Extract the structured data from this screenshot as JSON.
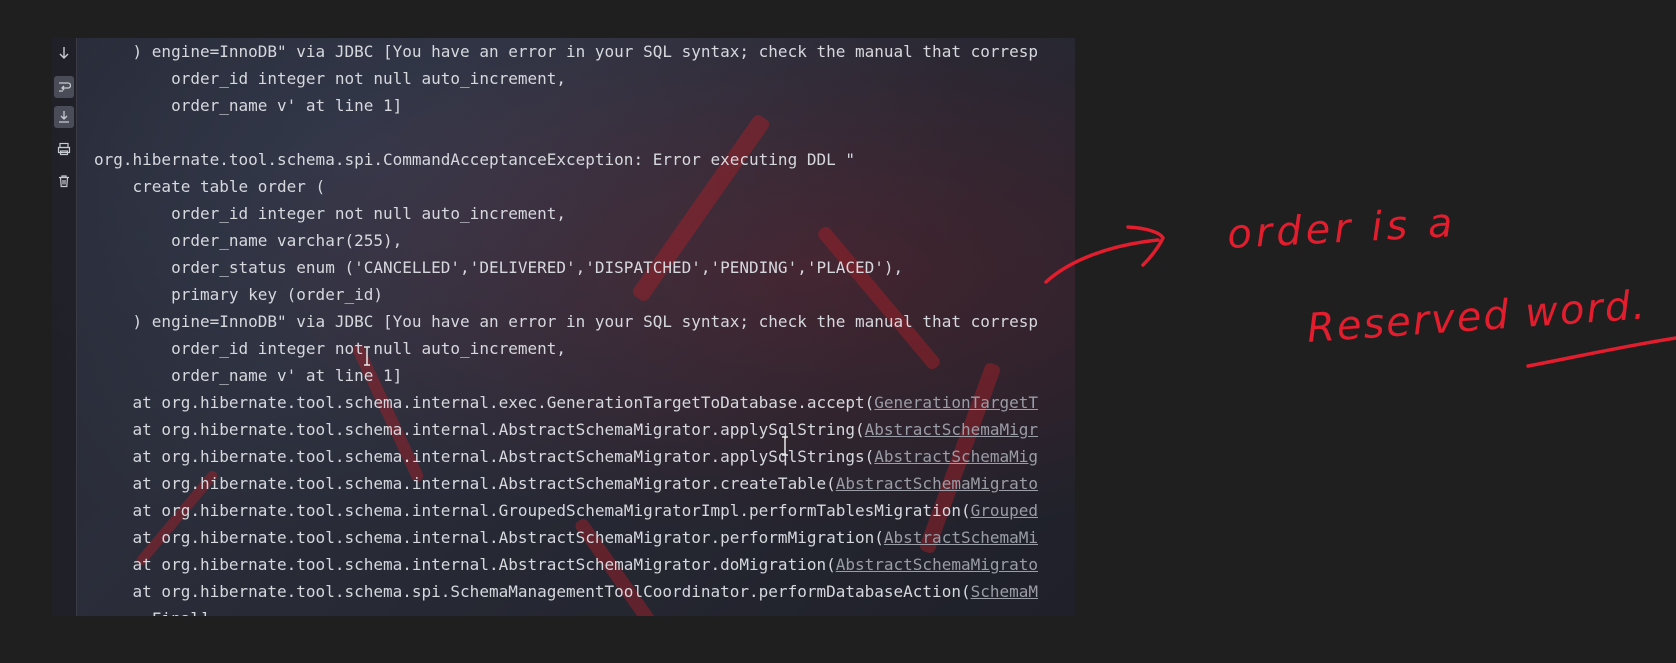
{
  "console": {
    "lines": [
      {
        "indent": "    ",
        "text": ") engine=InnoDB\" via JDBC [You have an error in your SQL syntax; check the manual that corresp",
        "link": ""
      },
      {
        "indent": "        ",
        "text": "order_id integer not null auto_increment,",
        "link": ""
      },
      {
        "indent": "        ",
        "text": "order_name v' at line 1]",
        "link": ""
      },
      {
        "indent": "",
        "text": "",
        "link": ""
      },
      {
        "indent": "",
        "text": "org.hibernate.tool.schema.spi.CommandAcceptanceException: Error executing DDL \"",
        "link": ""
      },
      {
        "indent": "    ",
        "text": "create table order (",
        "link": ""
      },
      {
        "indent": "        ",
        "text": "order_id integer not null auto_increment,",
        "link": ""
      },
      {
        "indent": "        ",
        "text": "order_name varchar(255),",
        "link": ""
      },
      {
        "indent": "        ",
        "text": "order_status enum ('CANCELLED','DELIVERED','DISPATCHED','PENDING','PLACED'),",
        "link": ""
      },
      {
        "indent": "        ",
        "text": "primary key (order_id)",
        "link": ""
      },
      {
        "indent": "    ",
        "text": ") engine=InnoDB\" via JDBC [You have an error in your SQL syntax; check the manual that corresp",
        "link": ""
      },
      {
        "indent": "        ",
        "text": "order_id integer not null auto_increment,",
        "link": ""
      },
      {
        "indent": "        ",
        "text": "order_name v' at line 1]",
        "link": ""
      },
      {
        "indent": "    ",
        "text": "at org.hibernate.tool.schema.internal.exec.GenerationTargetToDatabase.accept(",
        "link": "GenerationTargetT"
      },
      {
        "indent": "    ",
        "text": "at org.hibernate.tool.schema.internal.AbstractSchemaMigrator.applySqlString(",
        "link": "AbstractSchemaMigr"
      },
      {
        "indent": "    ",
        "text": "at org.hibernate.tool.schema.internal.AbstractSchemaMigrator.applySqlStrings(",
        "link": "AbstractSchemaMig"
      },
      {
        "indent": "    ",
        "text": "at org.hibernate.tool.schema.internal.AbstractSchemaMigrator.createTable(",
        "link": "AbstractSchemaMigrato"
      },
      {
        "indent": "    ",
        "text": "at org.hibernate.tool.schema.internal.GroupedSchemaMigratorImpl.performTablesMigration(",
        "link": "Grouped"
      },
      {
        "indent": "    ",
        "text": "at org.hibernate.tool.schema.internal.AbstractSchemaMigrator.performMigration(",
        "link": "AbstractSchemaMi"
      },
      {
        "indent": "    ",
        "text": "at org.hibernate.tool.schema.internal.AbstractSchemaMigrator.doMigration(",
        "link": "AbstractSchemaMigrato"
      },
      {
        "indent": "    ",
        "text": "at org.hibernate.tool.schema.spi.SchemaManagementToolCoordinator.performDatabaseAction(",
        "link": "SchemaM"
      },
      {
        "indent": "      ",
        "text": "Final]",
        "link": ""
      }
    ]
  },
  "gutter": {
    "icons": [
      "scroll-down-icon",
      "soft-wrap-icon",
      "scroll-to-end-icon",
      "print-icon",
      "clear-all-icon"
    ],
    "active": [
      "soft-wrap-icon",
      "scroll-to-end-icon"
    ]
  },
  "annotation": {
    "line1": "order is a",
    "line2": "Reserved word.",
    "color": "#e11d2e"
  },
  "colors": {
    "background": "#1f1f1f",
    "text": "#d6d8de",
    "link": "#9a9ca6"
  }
}
